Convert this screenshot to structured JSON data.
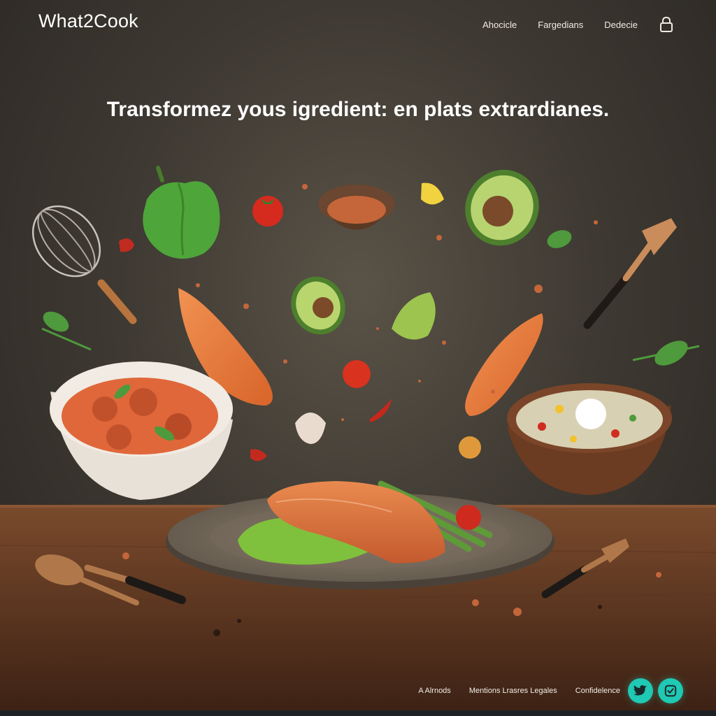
{
  "header": {
    "brand": "What2Cook",
    "nav": [
      "Ahocicle",
      "Fargedians",
      "Dedecie"
    ],
    "icon": "lock-icon"
  },
  "hero": {
    "headline": "Transformez yous igredient: en plats extrardianes."
  },
  "footer": {
    "links": [
      "A Alrnods",
      "Mentions Lrasres Legales",
      "Confidelence"
    ],
    "social_icons": [
      "twitter-icon",
      "instagram-icon"
    ]
  },
  "colors": {
    "background": "#3f3a33",
    "table": "#6b4027",
    "accent": "#1fc9b4",
    "text": "#ffffff"
  }
}
